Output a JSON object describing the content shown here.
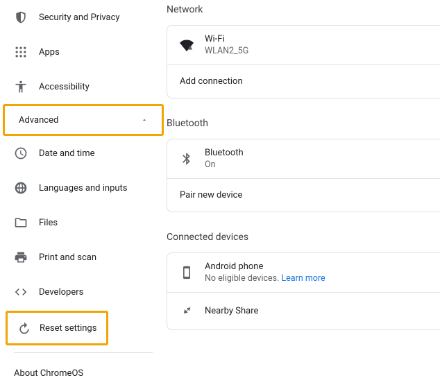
{
  "sidebar": {
    "items": [
      {
        "label": "Security and Privacy"
      },
      {
        "label": "Apps"
      },
      {
        "label": "Accessibility"
      }
    ],
    "advanced_label": "Advanced",
    "advanced_items": [
      {
        "label": "Date and time"
      },
      {
        "label": "Languages and inputs"
      },
      {
        "label": "Files"
      },
      {
        "label": "Print and scan"
      },
      {
        "label": "Developers"
      },
      {
        "label": "Reset settings"
      }
    ],
    "about": "About ChromeOS"
  },
  "main": {
    "network": {
      "title": "Network",
      "wifi_label": "Wi-Fi",
      "wifi_ssid": "WLAN2_5G",
      "add_connection": "Add connection"
    },
    "bluetooth": {
      "title": "Bluetooth",
      "label": "Bluetooth",
      "status": "On",
      "pair": "Pair new device"
    },
    "connected": {
      "title": "Connected devices",
      "android_label": "Android phone",
      "android_sub": "No eligible devices. ",
      "learn_more": "Learn more",
      "nearby_label": "Nearby Share"
    }
  }
}
